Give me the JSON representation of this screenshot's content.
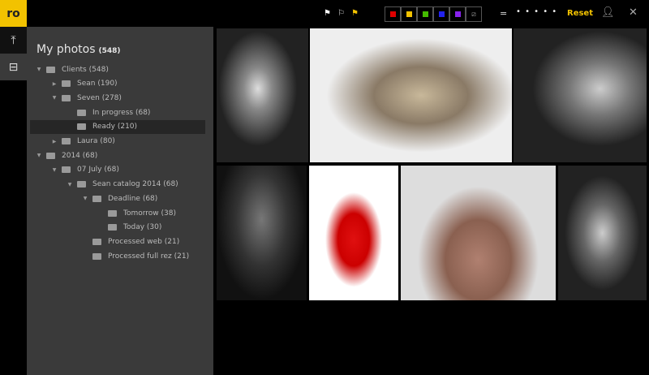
{
  "app": {
    "logo": "ro"
  },
  "rail": [
    {
      "icon": "upload-icon",
      "glyph": "⤒"
    },
    {
      "icon": "folder-tree-icon",
      "glyph": "⊟"
    }
  ],
  "panel": {
    "title": "My photos",
    "count": "(548)",
    "tree": [
      {
        "label": "Clients",
        "count": "(548)",
        "depth": 0,
        "toggle": "▼"
      },
      {
        "label": "Sean",
        "count": "(190)",
        "depth": 1,
        "toggle": "▶"
      },
      {
        "label": "Seven",
        "count": "(278)",
        "depth": 1,
        "toggle": "▼"
      },
      {
        "label": "In progress",
        "count": "(68)",
        "depth": 2,
        "toggle": ""
      },
      {
        "label": "Ready",
        "count": "(210)",
        "depth": 2,
        "toggle": "",
        "selected": true
      },
      {
        "label": "Laura",
        "count": "(80)",
        "depth": 1,
        "toggle": "▶"
      },
      {
        "label": "2014",
        "count": "(68)",
        "depth": 0,
        "toggle": "▼"
      },
      {
        "label": "07 July",
        "count": "(68)",
        "depth": 1,
        "toggle": "▼"
      },
      {
        "label": "Sean catalog 2014",
        "count": "(68)",
        "depth": 2,
        "toggle": "▼"
      },
      {
        "label": "Deadline",
        "count": "(68)",
        "depth": 3,
        "toggle": "▼"
      },
      {
        "label": "Tomorrow",
        "count": "(38)",
        "depth": 4,
        "toggle": ""
      },
      {
        "label": "Today",
        "count": "(30)",
        "depth": 4,
        "toggle": ""
      },
      {
        "label": "Processed web",
        "count": "(21)",
        "depth": 3,
        "toggle": ""
      },
      {
        "label": "Processed full rez",
        "count": "(21)",
        "depth": 3,
        "toggle": ""
      }
    ]
  },
  "toolbar": {
    "flags": [
      {
        "name": "flag-white",
        "color": "#ffffff"
      },
      {
        "name": "flag-outline",
        "color": "#dddddd"
      },
      {
        "name": "flag-yellow",
        "color": "#f2c200"
      }
    ],
    "color_labels": [
      "#e00000",
      "#f2c200",
      "#44bb00",
      "#2222ee",
      "#8822ee"
    ],
    "no_color_icon": "no-color-icon",
    "rating_operator": "=",
    "rating_dots": "• • • • •",
    "reset_label": "Reset",
    "accent": "#f2c200"
  },
  "photos": [
    "bw-model-arms-raised",
    "bw-blonde-profile",
    "bw-man-looking-up",
    "dancer-silhouette",
    "woman-red-top",
    "man-sunglasses-beige-blazer",
    "bw-woman-patterned-top"
  ]
}
